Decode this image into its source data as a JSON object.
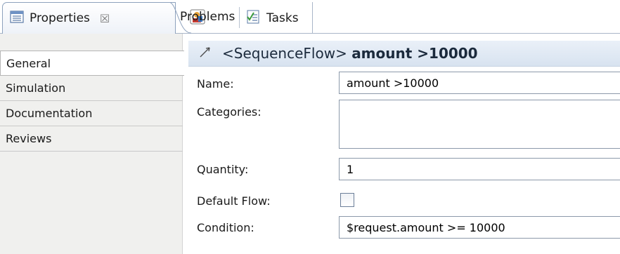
{
  "tabs": [
    {
      "label": "Properties",
      "active": true,
      "icon": "properties-icon",
      "closable": true
    },
    {
      "label": "Problems",
      "active": false,
      "icon": "problems-icon"
    },
    {
      "label": "Tasks",
      "active": false,
      "icon": "tasks-icon"
    }
  ],
  "close_glyph": "☒",
  "categories": [
    "General",
    "Simulation",
    "Documentation",
    "Reviews"
  ],
  "selected_category": "General",
  "header": {
    "icon": "sequence-flow-icon",
    "type_label": "<SequenceFlow>",
    "element_name": "amount >10000"
  },
  "form": {
    "name_label": "Name:",
    "name_value": "amount >10000",
    "categories_label": "Categories:",
    "categories_value": "",
    "quantity_label": "Quantity:",
    "quantity_value": "1",
    "default_flow_label": "Default Flow:",
    "default_flow_checked": false,
    "condition_label": "Condition:",
    "condition_value": "$request.amount >= 10000"
  },
  "colors": {
    "header_gradient_top": "#eaf0f8",
    "header_gradient_bottom": "#d8e3f0",
    "list_background": "#f0f0ee"
  }
}
